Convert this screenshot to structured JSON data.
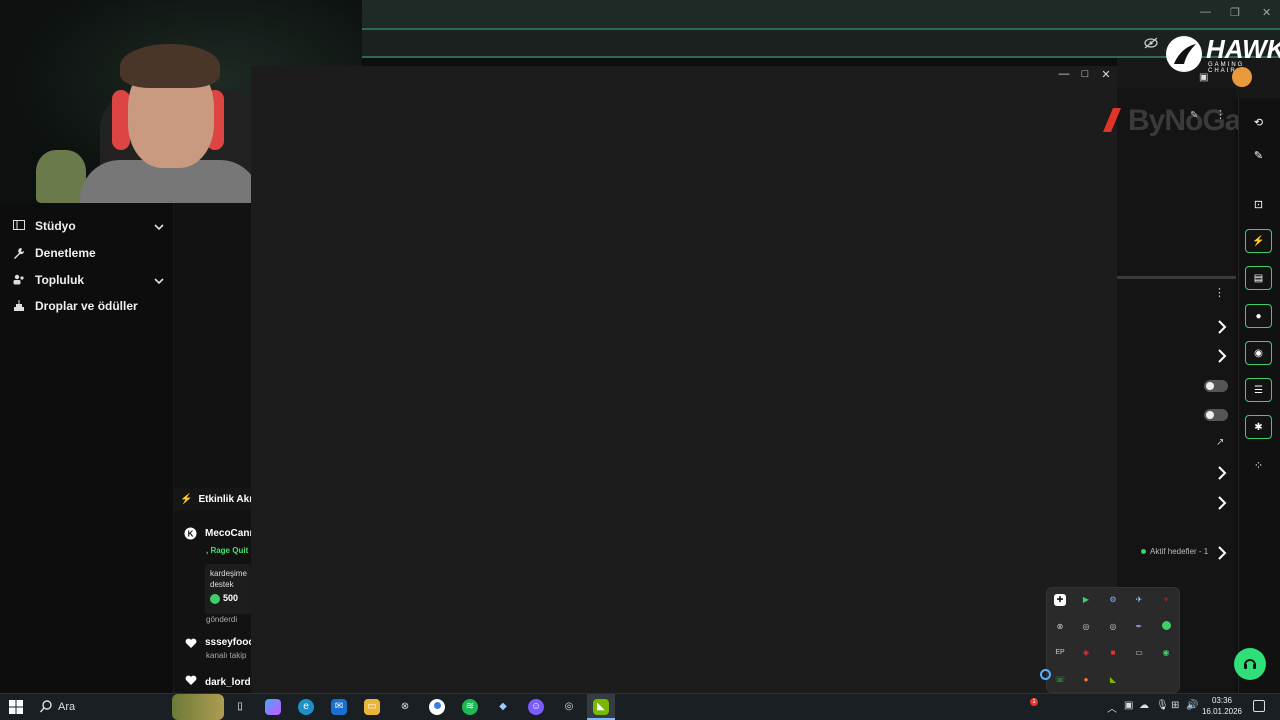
{
  "sidebar": {
    "items": [
      {
        "label": "Stüdyo",
        "icon": "studio-icon",
        "expandable": true
      },
      {
        "label": "Denetleme",
        "icon": "wrench-icon",
        "expandable": false
      },
      {
        "label": "Topluluk",
        "icon": "community-icon",
        "expandable": true
      },
      {
        "label": "Droplar ve ödüller",
        "icon": "drops-icon",
        "expandable": false
      }
    ]
  },
  "feed": {
    "title": "Etkinlik Akışı",
    "items": [
      {
        "name": "MecoCanı",
        "highlight": ", Rage Quit",
        "card_text": "kardeşime destek",
        "amount": "500",
        "footer": "gönderdi",
        "icon": "kick-icon"
      },
      {
        "name": "ssseyfooo",
        "sub": "kanalı takip",
        "icon": "heart-icon"
      },
      {
        "name": "dark_lord",
        "icon": "heart-icon"
      }
    ]
  },
  "right_panel": {
    "goals_label": "Aktif hedefler - 1"
  },
  "logos": {
    "hawk": "HAWK",
    "hawk_sub": "GAMING CHAIR",
    "byno": "ByNoGame"
  },
  "taskbar": {
    "search_label": "Ara",
    "time": "03:36",
    "date": "16.01.2026",
    "notification_count": "1"
  },
  "colors": {
    "accent": "#3fcf6a",
    "topbar": "#1f2a26"
  }
}
